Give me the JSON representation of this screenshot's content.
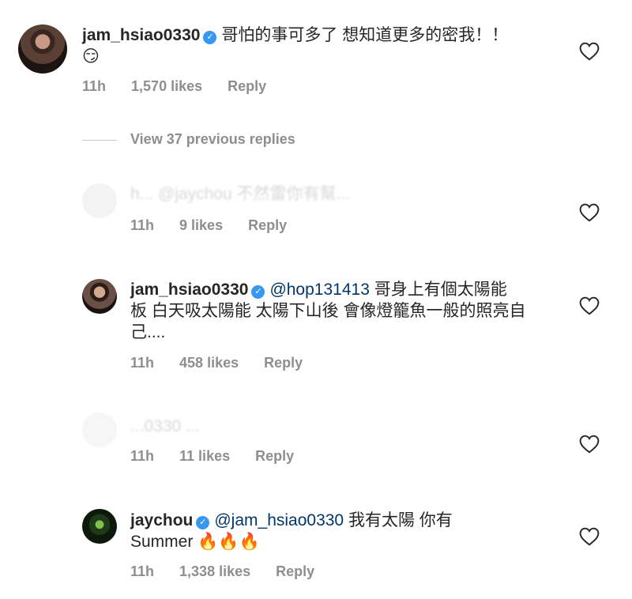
{
  "comments": [
    {
      "username": "jam_hsiao0330",
      "verified": true,
      "mention": "",
      "text": "哥怕的事可多了 想知道更多的密我！！",
      "text_line2": "😏",
      "time": "11h",
      "likes": "1,570 likes",
      "reply_label": "Reply"
    }
  ],
  "view_replies": "View 37 previous replies",
  "replies": [
    {
      "faded": true,
      "text": "h... @jaychou 不然雷你有幫...",
      "time": "11h",
      "likes": "9 likes",
      "reply_label": "Reply"
    },
    {
      "username": "jam_hsiao0330",
      "verified": true,
      "mention": "@hop131413",
      "text_line1": " 哥身上有個太陽能",
      "text_line2": "板 白天吸太陽能 太陽下山後 會像燈籠魚一般的照亮自",
      "text_line3": "己....",
      "time": "11h",
      "likes": "458 likes",
      "reply_label": "Reply"
    },
    {
      "faded": true,
      "text": "...0330 ...",
      "time": "11h",
      "likes": "11 likes",
      "reply_label": "Reply"
    },
    {
      "username": "jaychou",
      "verified": true,
      "mention": "@jam_hsiao0330",
      "text_line1": " 我有太陽 你有",
      "text_line2": "Summer 🔥🔥🔥",
      "time": "11h",
      "likes": "1,338 likes",
      "reply_label": "Reply"
    }
  ],
  "icons": {
    "heart": "heart-icon",
    "verified": "verified-badge-icon"
  },
  "colors": {
    "verified": "#3897f0",
    "meta": "#8e8e8e",
    "mention": "#00376b"
  }
}
